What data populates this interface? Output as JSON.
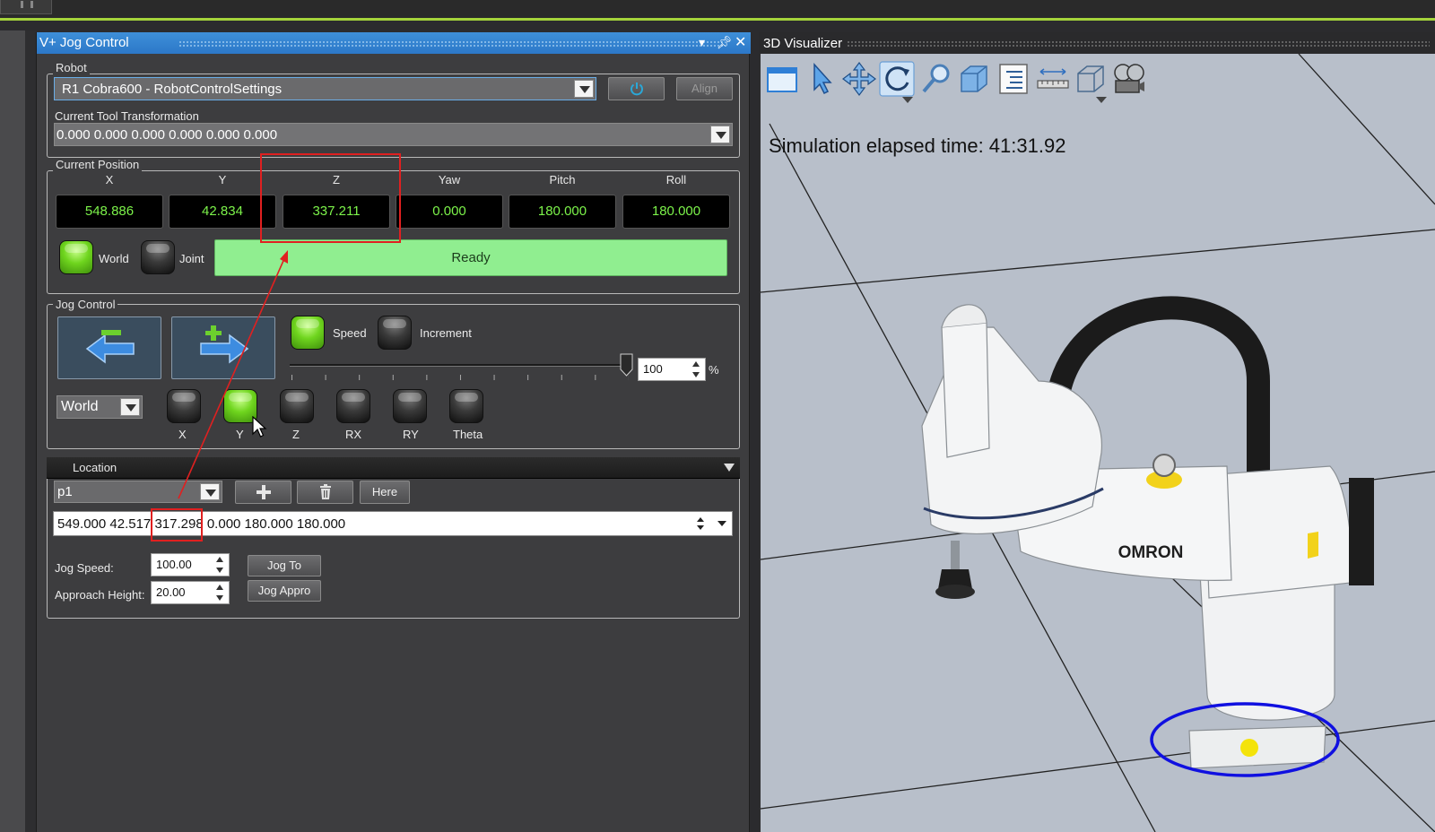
{
  "jog_panel": {
    "title": "V+ Jog Control",
    "robot_group": "Robot",
    "robot_select": "R1 Cobra600  -  RobotControlSettings",
    "align_label": "Align",
    "tool_label": "Current Tool Transformation",
    "tool_value": "0.000 0.000 0.000 0.000 0.000 0.000"
  },
  "position": {
    "group": "Current Position",
    "headers": [
      "X",
      "Y",
      "Z",
      "Yaw",
      "Pitch",
      "Roll"
    ],
    "values": [
      "548.886",
      "42.834",
      "337.211",
      "0.000",
      "180.000",
      "180.000"
    ],
    "world_label": "World",
    "joint_label": "Joint",
    "status": "Ready"
  },
  "jog": {
    "group": "Jog Control",
    "speed_label": "Speed",
    "increment_label": "Increment",
    "speed_value": "100",
    "percent": "%",
    "speed_fraction": 1.0,
    "frame_select": "World",
    "axes": [
      "X",
      "Y",
      "Z",
      "RX",
      "RY",
      "Theta"
    ],
    "active_axis": "Y"
  },
  "location": {
    "title": "Location",
    "select": "p1",
    "here_label": "Here",
    "value_part1": "549.000 42.517 ",
    "value_z": "317.298",
    "value_part2": " 0.000 180.000 180.000",
    "jog_speed_label": "Jog Speed:",
    "jog_speed_value": "100.00",
    "approach_label": "Approach Height:",
    "approach_value": "20.00",
    "jog_to_label": "Jog To",
    "jog_appro_label": "Jog Appro"
  },
  "viz": {
    "title": "3D Visualizer",
    "sim_time": "Simulation elapsed time: 41:31.92",
    "brand": "OMRON"
  },
  "colors": {
    "title_blue": "#2f80d0",
    "readout_green": "#7cf34a",
    "ready_green": "#90ee90",
    "annotation_red": "#e02020",
    "highlight_blue": "#1010e0"
  }
}
